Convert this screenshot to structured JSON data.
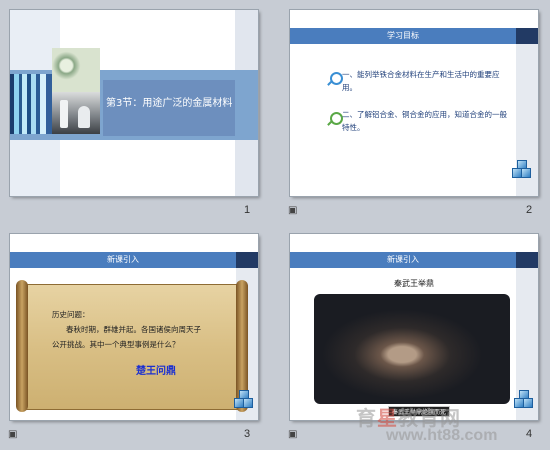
{
  "slides": [
    {
      "number": "1",
      "title": "第3节：用途广泛的金属材料"
    },
    {
      "number": "2",
      "header": "学习目标",
      "objectives": [
        "一、能列举铁合金材料在生产和生活中的重要应用。",
        "二、了解铝合金、铜合金的应用，知道合金的一般特性。"
      ]
    },
    {
      "number": "3",
      "header": "新课引入",
      "scroll": {
        "line1": "历史问题：",
        "line2": "春秋时期，群雄并起。各国诸侯向周天子公开挑战。其中一个典型事例是什么？",
        "answer": "楚王问鼎"
      }
    },
    {
      "number": "4",
      "header": "新课引入",
      "subtitle": "秦武王举鼎",
      "caption": "秦武王举鼎绝膑而死"
    }
  ],
  "notes_icon": "note-icon",
  "watermark": {
    "line1a": "育",
    "line1b": "星",
    "line1c": "教育网",
    "line2": "www.ht88.com"
  }
}
